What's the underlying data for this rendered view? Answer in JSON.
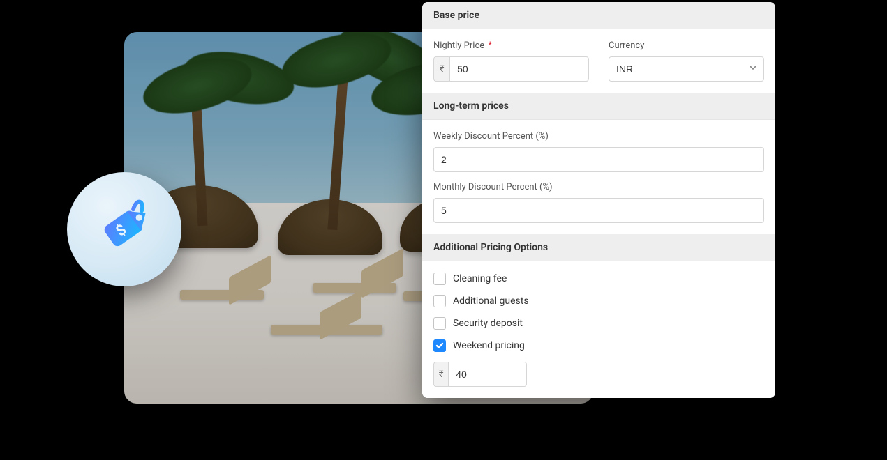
{
  "basePrice": {
    "header": "Base price",
    "nightly": {
      "label": "Nightly Price",
      "required": "*",
      "symbol": "₹",
      "value": "50"
    },
    "currency": {
      "label": "Currency",
      "value": "INR"
    }
  },
  "longTerm": {
    "header": "Long-term prices",
    "weekly": {
      "label": "Weekly Discount Percent (%)",
      "value": "2"
    },
    "monthly": {
      "label": "Monthly Discount Percent (%)",
      "value": "5"
    }
  },
  "additional": {
    "header": "Additional Pricing Options",
    "cleaning": {
      "label": "Cleaning fee",
      "checked": false
    },
    "guests": {
      "label": "Additional guests",
      "checked": false
    },
    "deposit": {
      "label": "Security deposit",
      "checked": false
    },
    "weekend": {
      "label": "Weekend pricing",
      "checked": true,
      "symbol": "₹",
      "value": "40"
    }
  }
}
